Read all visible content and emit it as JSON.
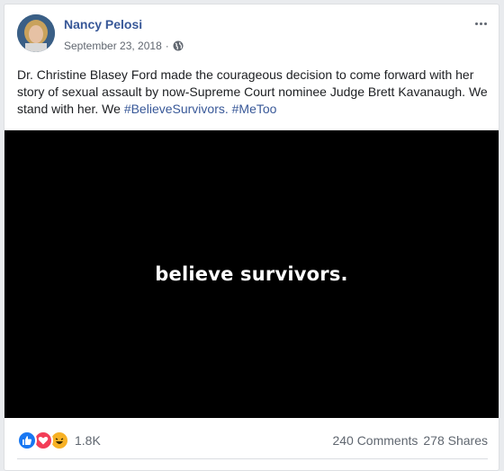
{
  "post": {
    "author": "Nancy Pelosi",
    "date": "September 23, 2018",
    "separator": "·",
    "text_main": "Dr. Christine Blasey Ford made the courageous decision to come forward with her story of sexual assault by now-Supreme Court nominee Judge Brett Kavanaugh. We stand with her. We ",
    "hashtag1": "#BelieveSurvivors.",
    "hashtag2": "#MeToo",
    "video_caption": "believe survivors.",
    "reaction_count": "1.8K",
    "comments": "240 Comments",
    "shares": "278 Shares"
  },
  "colors": {
    "link": "#385898",
    "like": "#1877f2",
    "love": "#f33e58",
    "haha": "#f7b125"
  },
  "icons": [
    "globe-icon",
    "more-options-icon",
    "like-reaction-icon",
    "love-reaction-icon",
    "haha-reaction-icon"
  ]
}
